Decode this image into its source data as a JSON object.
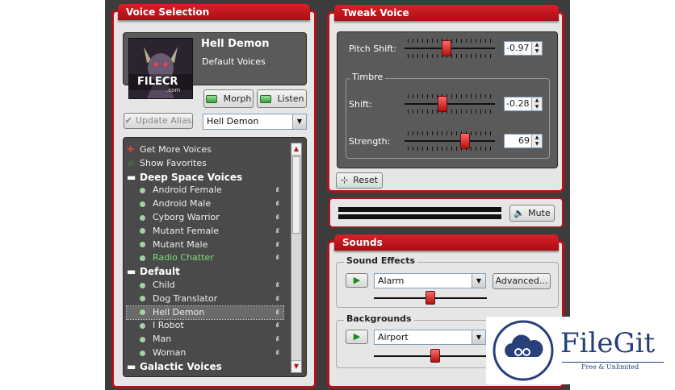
{
  "voice_selection": {
    "title": "Voice Selection",
    "voice_name": "Hell Demon",
    "voice_group": "Default Voices",
    "thumbnail_text": "FILECR",
    "thumbnail_subtext": ".com",
    "morph_label": "Morph",
    "listen_label": "Listen",
    "update_alias_label": "Update Alias",
    "alias_value": "Hell Demon",
    "list": {
      "actions": [
        "Get More Voices",
        "Show Favorites"
      ],
      "groups": [
        {
          "name": "Deep Space Voices",
          "items": [
            "Android Female",
            "Android Male",
            "Cyborg Warrior",
            "Mutant Female",
            "Mutant Male",
            "Radio Chatter"
          ]
        },
        {
          "name": "Default",
          "items": [
            "Child",
            "Dog Translator",
            "Hell Demon",
            "I Robot",
            "Man",
            "Woman"
          ]
        },
        {
          "name": "Galactic Voices",
          "items": []
        }
      ],
      "selected": "Hell Demon",
      "highlight": "Radio Chatter"
    }
  },
  "tweak_voice": {
    "title": "Tweak Voice",
    "pitch_shift_label": "Pitch Shift:",
    "pitch_shift_value": "-0.97",
    "pitch_shift_level": 0.46,
    "timbre_label": "Timbre",
    "shift_label": "Shift:",
    "shift_value": "-0.28",
    "shift_level": 0.41,
    "strength_label": "Strength:",
    "strength_value": "69",
    "strength_level": 0.69,
    "reset_label": "Reset"
  },
  "meter": {
    "mute_label": "Mute"
  },
  "sounds": {
    "title": "Sounds",
    "effects_label": "Sound Effects",
    "effect_value": "Alarm",
    "effect_level": 0.5,
    "advanced_label": "Advanced...",
    "backgrounds_label": "Backgrounds",
    "background_value": "Airport",
    "background_level": 0.55
  },
  "watermark": {
    "name": "FileGit",
    "tagline": "Free & Unlimited"
  },
  "colors": {
    "accent": "#b3121b",
    "panel": "#e6e6e6",
    "dark": "#3c3c3c",
    "highlight": "#7ddc7d"
  }
}
